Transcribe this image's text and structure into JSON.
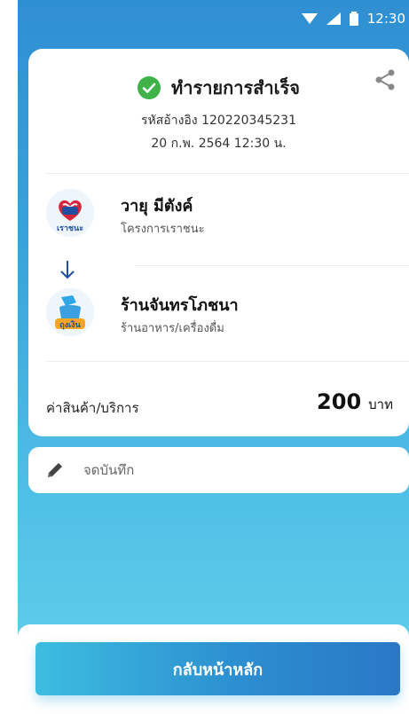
{
  "status_bar": {
    "time": "12:30"
  },
  "transaction": {
    "title": "ทำรายการสำเร็จ",
    "reference": "รหัสอ้างอิง 120220345231",
    "datetime": "20 ก.พ. 2564 12:30 น."
  },
  "sender": {
    "name": "วายุ มีตังค์",
    "subtitle": "โครงการเราชนะ",
    "logo_label": "เราชนะ"
  },
  "receiver": {
    "name": "ร้านจันทรโภชนา",
    "subtitle": "ร้านอาหาร/เครื่องดื่ม",
    "logo_label": "ถุงเงิน"
  },
  "amount": {
    "label": "ค่าสินค้า/บริการ",
    "value": "200",
    "unit": "บาท"
  },
  "note": {
    "placeholder": "จดบันทึก"
  },
  "actions": {
    "home_label": "กลับหน้าหลัก"
  },
  "colors": {
    "accent": "#2c8fd0",
    "success": "#3fb24a",
    "background_top": "#2f8fd2",
    "background_bottom": "#5ccbe9"
  },
  "icons": [
    "wifi-icon",
    "signal-icon",
    "battery-icon",
    "check-circle-icon",
    "share-icon",
    "arrow-down-icon",
    "pencil-icon"
  ]
}
